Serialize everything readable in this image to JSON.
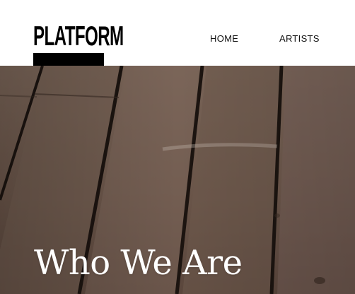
{
  "header": {
    "logo_text": "PLATFORM",
    "nav": [
      {
        "label": "HOME"
      },
      {
        "label": "ARTISTS"
      }
    ]
  },
  "hero": {
    "title": "Who We Are"
  },
  "colors": {
    "header_bg": "#ffffff",
    "logo": "#000000",
    "hero_wood": "#6a554a",
    "hero_text": "#ffffff"
  }
}
